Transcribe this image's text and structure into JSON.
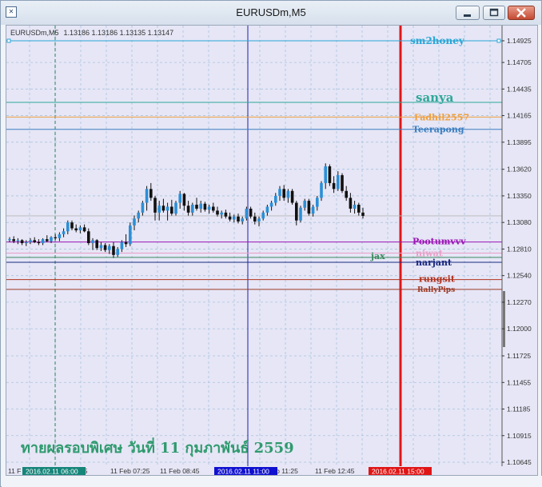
{
  "window": {
    "title": "EURUSDm,M5",
    "app_icon": "mt4-chart-icon",
    "buttons": [
      "minimize-icon",
      "maximize-icon",
      "close-icon"
    ]
  },
  "info_line": {
    "symbol": "EURUSDm,M5",
    "ohlc": "1.13186 1.13186 1.13135 1.13147"
  },
  "thai_caption": "ทายผลรอบพิเศษ วันที่ 11 กุมภาพันธ์ 2559",
  "chart_data": {
    "type": "candlestick",
    "y_ticks": [
      "1.14925",
      "1.14705",
      "1.14435",
      "1.14165",
      "1.13895",
      "1.13620",
      "1.13350",
      "1.13080",
      "1.12810",
      "1.12540",
      "1.12270",
      "1.12000",
      "1.11725",
      "1.11455",
      "1.11185",
      "1.10915",
      "1.10645"
    ],
    "ylim": [
      1.10645,
      1.14925
    ],
    "x_ticks": [
      "11 Feb 06:05",
      "11 Feb 07:25",
      "11 Feb 08:45",
      "11 Feb 11:25",
      "11 Feb 12:45"
    ],
    "x_first_tick_partial": "11 F",
    "current_price": "1.13147",
    "cursor_labels": [
      {
        "text": "2016.02.11 06:00",
        "color": "#16857a"
      },
      {
        "text": "2016.02.11 11:00",
        "color": "#1010d0"
      },
      {
        "text": "2016.02.11 15:00",
        "color": "#e01616"
      }
    ],
    "horizontal_lines": [
      {
        "name": "sm2honey",
        "price": "1.14925",
        "value": 1.14925,
        "color": "#2aa7d6"
      },
      {
        "name": "sanya",
        "price": "1.14300",
        "value": 1.143,
        "color": "#2fa899"
      },
      {
        "name": "Fadhil2557",
        "price": "1.14150",
        "value": 1.1415,
        "color": "#f0a040"
      },
      {
        "name": "Teerapong",
        "price": "1.14026",
        "value": 1.14026,
        "color": "#3c7fc0"
      },
      {
        "name": "Pootumvvv",
        "price": "1.12881",
        "value": 1.12881,
        "color": "#9b16b5"
      },
      {
        "name": "niwat",
        "price": "1.12769",
        "value": 1.12769,
        "color": "#e8a0c8"
      },
      {
        "name": "jax",
        "price": "",
        "value": 1.12725,
        "color": "#3d8a60"
      },
      {
        "name": "narjant",
        "price": "1.12675",
        "value": 1.12675,
        "color": "#1b2a80"
      },
      {
        "name": "rungsit",
        "price": "1.12500",
        "value": 1.125,
        "color": "#b0331f"
      },
      {
        "name": "RallyPips",
        "price": "1.12400",
        "value": 1.124,
        "color": "#9c3a26"
      }
    ],
    "candles": [
      [
        1.129,
        1.1293,
        1.1288,
        1.1291
      ],
      [
        1.1291,
        1.1294,
        1.1287,
        1.1289
      ],
      [
        1.1289,
        1.1292,
        1.1286,
        1.129
      ],
      [
        1.129,
        1.1291,
        1.1285,
        1.1287
      ],
      [
        1.1287,
        1.129,
        1.1284,
        1.1288
      ],
      [
        1.1288,
        1.1292,
        1.1286,
        1.129
      ],
      [
        1.129,
        1.1293,
        1.1287,
        1.1288
      ],
      [
        1.1288,
        1.1291,
        1.1285,
        1.1287
      ],
      [
        1.1287,
        1.1292,
        1.1285,
        1.1291
      ],
      [
        1.1291,
        1.1295,
        1.1288,
        1.1289
      ],
      [
        1.1289,
        1.1294,
        1.1287,
        1.1293
      ],
      [
        1.1293,
        1.1296,
        1.129,
        1.1292
      ],
      [
        1.1292,
        1.1298,
        1.1289,
        1.1296
      ],
      [
        1.1296,
        1.1302,
        1.1293,
        1.1299
      ],
      [
        1.1299,
        1.131,
        1.1296,
        1.1308
      ],
      [
        1.1308,
        1.131,
        1.13,
        1.1302
      ],
      [
        1.1302,
        1.1306,
        1.1298,
        1.13
      ],
      [
        1.13,
        1.1305,
        1.1297,
        1.1303
      ],
      [
        1.1303,
        1.1306,
        1.1298,
        1.1299
      ],
      [
        1.1299,
        1.1302,
        1.1285,
        1.1287
      ],
      [
        1.1287,
        1.1292,
        1.128,
        1.129
      ],
      [
        1.129,
        1.1291,
        1.128,
        1.1282
      ],
      [
        1.1282,
        1.1288,
        1.1279,
        1.1285
      ],
      [
        1.1285,
        1.1287,
        1.1278,
        1.128
      ],
      [
        1.128,
        1.1286,
        1.1276,
        1.1284
      ],
      [
        1.1284,
        1.1288,
        1.1272,
        1.1275
      ],
      [
        1.1275,
        1.1283,
        1.1273,
        1.1281
      ],
      [
        1.1281,
        1.129,
        1.1278,
        1.1288
      ],
      [
        1.1288,
        1.1296,
        1.1283,
        1.1286
      ],
      [
        1.1286,
        1.1308,
        1.1284,
        1.1305
      ],
      [
        1.1305,
        1.1315,
        1.13,
        1.1312
      ],
      [
        1.1312,
        1.132,
        1.1308,
        1.1318
      ],
      [
        1.1318,
        1.133,
        1.1315,
        1.1328
      ],
      [
        1.1328,
        1.1345,
        1.132,
        1.1342
      ],
      [
        1.1342,
        1.1348,
        1.133,
        1.1333
      ],
      [
        1.1333,
        1.1335,
        1.131,
        1.1318
      ],
      [
        1.1318,
        1.133,
        1.131,
        1.1325
      ],
      [
        1.1325,
        1.1332,
        1.1318,
        1.132
      ],
      [
        1.132,
        1.1328,
        1.131,
        1.1324
      ],
      [
        1.1324,
        1.1331,
        1.1315,
        1.1317
      ],
      [
        1.1317,
        1.133,
        1.1315,
        1.1328
      ],
      [
        1.1328,
        1.134,
        1.1322,
        1.1337
      ],
      [
        1.1337,
        1.1338,
        1.132,
        1.1325
      ],
      [
        1.1325,
        1.133,
        1.1315,
        1.1318
      ],
      [
        1.1318,
        1.1328,
        1.1315,
        1.1326
      ],
      [
        1.1326,
        1.1333,
        1.132,
        1.1322
      ],
      [
        1.1322,
        1.133,
        1.1318,
        1.1327
      ],
      [
        1.1327,
        1.1329,
        1.1319,
        1.1321
      ],
      [
        1.1321,
        1.1326,
        1.1317,
        1.1324
      ],
      [
        1.1324,
        1.1328,
        1.1318,
        1.132
      ],
      [
        1.132,
        1.1324,
        1.1314,
        1.1316
      ],
      [
        1.1316,
        1.132,
        1.1312,
        1.1318
      ],
      [
        1.1318,
        1.1321,
        1.1312,
        1.1314
      ],
      [
        1.1314,
        1.1318,
        1.1309,
        1.1311
      ],
      [
        1.1311,
        1.1316,
        1.1308,
        1.1314
      ],
      [
        1.1314,
        1.1317,
        1.1307,
        1.1309
      ],
      [
        1.1309,
        1.1314,
        1.1306,
        1.1312
      ],
      [
        1.1312,
        1.1324,
        1.131,
        1.1322
      ],
      [
        1.1322,
        1.1324,
        1.1312,
        1.1314
      ],
      [
        1.1314,
        1.1318,
        1.1306,
        1.1309
      ],
      [
        1.1309,
        1.1314,
        1.1304,
        1.1312
      ],
      [
        1.1312,
        1.132,
        1.131,
        1.1318
      ],
      [
        1.1318,
        1.1326,
        1.1315,
        1.1324
      ],
      [
        1.1324,
        1.133,
        1.132,
        1.1328
      ],
      [
        1.1328,
        1.1338,
        1.1325,
        1.1335
      ],
      [
        1.1335,
        1.1345,
        1.133,
        1.1342
      ],
      [
        1.1342,
        1.1346,
        1.133,
        1.1333
      ],
      [
        1.1333,
        1.1342,
        1.1328,
        1.134
      ],
      [
        1.134,
        1.1342,
        1.1326,
        1.1328
      ],
      [
        1.1328,
        1.133,
        1.1305,
        1.131
      ],
      [
        1.131,
        1.1325,
        1.1308,
        1.1323
      ],
      [
        1.1323,
        1.1332,
        1.132,
        1.133
      ],
      [
        1.133,
        1.1332,
        1.1315,
        1.1317
      ],
      [
        1.1317,
        1.1326,
        1.1314,
        1.1324
      ],
      [
        1.1324,
        1.1335,
        1.132,
        1.1333
      ],
      [
        1.1333,
        1.135,
        1.133,
        1.1348
      ],
      [
        1.1348,
        1.1368,
        1.1342,
        1.1365
      ],
      [
        1.1365,
        1.1367,
        1.1345,
        1.1348
      ],
      [
        1.1348,
        1.1355,
        1.1338,
        1.1342
      ],
      [
        1.1342,
        1.136,
        1.134,
        1.1356
      ],
      [
        1.1356,
        1.1358,
        1.1338,
        1.134
      ],
      [
        1.134,
        1.1345,
        1.133,
        1.1333
      ],
      [
        1.1333,
        1.1338,
        1.1318,
        1.1322
      ],
      [
        1.1322,
        1.133,
        1.1317,
        1.1326
      ],
      [
        1.1326,
        1.1328,
        1.1315,
        1.1318
      ],
      [
        1.1318,
        1.1323,
        1.1312,
        1.13147
      ]
    ]
  }
}
